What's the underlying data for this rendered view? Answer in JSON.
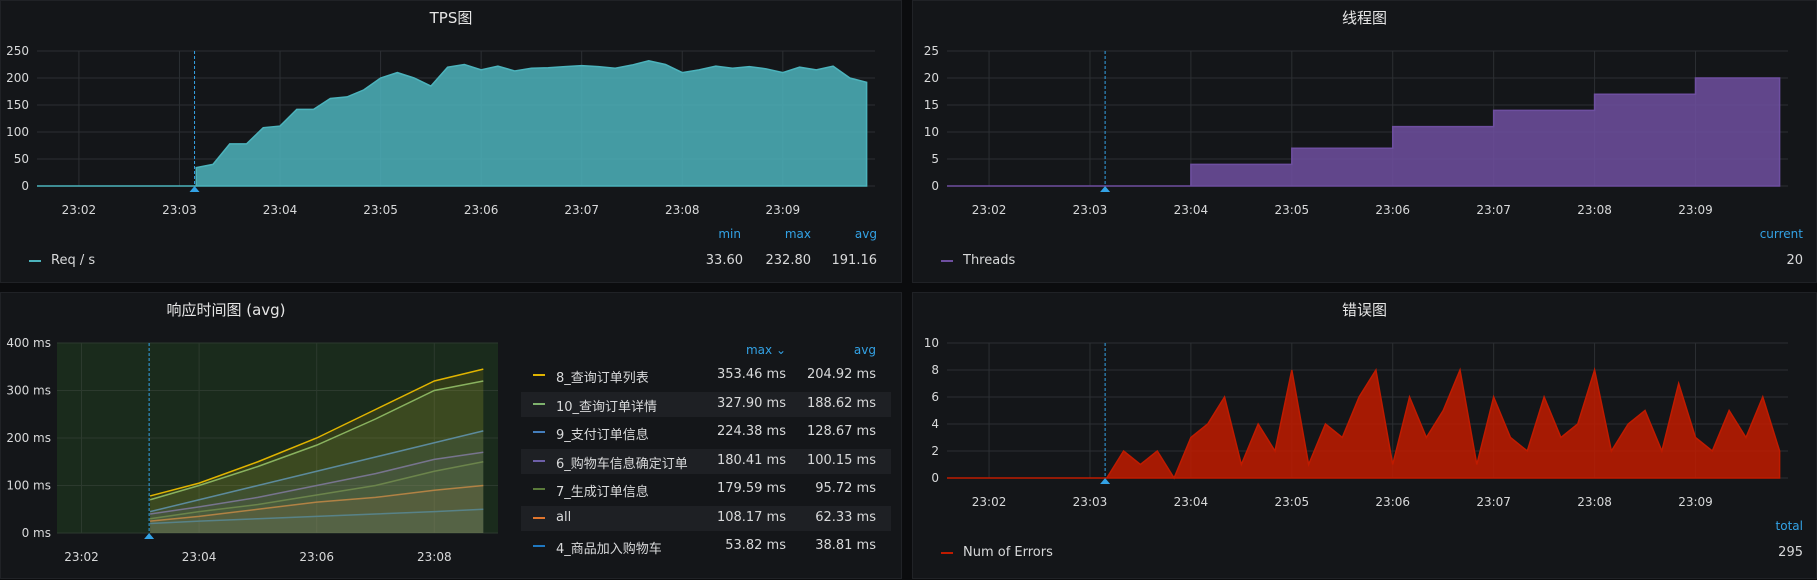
{
  "panels": {
    "tps": {
      "title": "TPS图",
      "yticks": [
        "250",
        "200",
        "150",
        "100",
        "50",
        "0"
      ],
      "xticks": [
        "23:02",
        "23:03",
        "23:04",
        "23:05",
        "23:06",
        "23:07",
        "23:08",
        "23:09"
      ],
      "legend_heads": {
        "min": "min",
        "max": "max",
        "avg": "avg"
      },
      "series_name": "Req / s",
      "stats": {
        "min": "33.60",
        "max": "232.80",
        "avg": "191.16"
      },
      "color": "#4cb3bc"
    },
    "threads": {
      "title": "线程图",
      "yticks": [
        "25",
        "20",
        "15",
        "10",
        "5",
        "0"
      ],
      "xticks": [
        "23:02",
        "23:03",
        "23:04",
        "23:05",
        "23:06",
        "23:07",
        "23:08",
        "23:09"
      ],
      "legend_head": "current",
      "series_name": "Threads",
      "current": "20",
      "color": "#6e4fa0"
    },
    "response": {
      "title": "响应时间图 (avg)",
      "yticks": [
        "400 ms",
        "300 ms",
        "200 ms",
        "100 ms",
        "0 ms"
      ],
      "xticks": [
        "23:02",
        "23:04",
        "23:06",
        "23:08"
      ],
      "legend_heads": {
        "max": "max ⌄",
        "avg": "avg"
      },
      "rows": [
        {
          "name": "8_查询订单列表",
          "max": "353.46 ms",
          "avg": "204.92 ms",
          "color": "#e0b400"
        },
        {
          "name": "10_查询订单详情",
          "max": "327.90 ms",
          "avg": "188.62 ms",
          "color": "#7eb26d"
        },
        {
          "name": "9_支付订单信息",
          "max": "224.38 ms",
          "avg": "128.67 ms",
          "color": "#447ebc"
        },
        {
          "name": "6_购物车信息确定订单",
          "max": "180.41 ms",
          "avg": "100.15 ms",
          "color": "#6d5fa8"
        },
        {
          "name": "7_生成订单信息",
          "max": "179.59 ms",
          "avg": "95.72 ms",
          "color": "#5a7a3a"
        },
        {
          "name": "all",
          "max": "108.17 ms",
          "avg": "62.33 ms",
          "color": "#e0752d"
        },
        {
          "name": "4_商品加入购物车",
          "max": "53.82 ms",
          "avg": "38.81 ms",
          "color": "#1f78c1"
        }
      ]
    },
    "errors": {
      "title": "错误图",
      "yticks": [
        "10",
        "8",
        "6",
        "4",
        "2",
        "0"
      ],
      "xticks": [
        "23:02",
        "23:03",
        "23:04",
        "23:05",
        "23:06",
        "23:07",
        "23:08",
        "23:09"
      ],
      "legend_head": "total",
      "series_name": "Num of Errors",
      "total": "295",
      "color": "#bf1b00"
    }
  },
  "chart_data": [
    {
      "type": "area",
      "title": "TPS图",
      "ylim": [
        0,
        250
      ],
      "x": [
        "23:03:10",
        "23:03:20",
        "23:03:30",
        "23:03:40",
        "23:03:50",
        "23:04:00",
        "23:04:10",
        "23:04:20",
        "23:04:30",
        "23:04:40",
        "23:04:50",
        "23:05:00",
        "23:05:10",
        "23:05:20",
        "23:05:30",
        "23:05:40",
        "23:05:50",
        "23:06:00",
        "23:06:10",
        "23:06:20",
        "23:06:30",
        "23:06:40",
        "23:06:50",
        "23:07:00",
        "23:07:10",
        "23:07:20",
        "23:07:30",
        "23:07:40",
        "23:07:50",
        "23:08:00",
        "23:08:10",
        "23:08:20",
        "23:08:30",
        "23:08:40",
        "23:08:50",
        "23:09:00",
        "23:09:10",
        "23:09:20",
        "23:09:30",
        "23:09:40",
        "23:09:50"
      ],
      "series": [
        {
          "name": "Req / s",
          "values": [
            34,
            40,
            78,
            78,
            108,
            111,
            142,
            142,
            162,
            165,
            178,
            200,
            210,
            200,
            185,
            220,
            225,
            215,
            222,
            213,
            218,
            219,
            221,
            223,
            221,
            218,
            224,
            232,
            225,
            210,
            215,
            222,
            218,
            221,
            217,
            210,
            220,
            215,
            222,
            200,
            192
          ]
        }
      ]
    },
    {
      "type": "area",
      "title": "线程图",
      "ylim": [
        0,
        25
      ],
      "x": [
        "23:03",
        "23:04",
        "23:05",
        "23:06",
        "23:07",
        "23:08",
        "23:09",
        "23:09:50"
      ],
      "series": [
        {
          "name": "Threads",
          "values": [
            0,
            4,
            7,
            11,
            14,
            17,
            20,
            20
          ]
        }
      ]
    },
    {
      "type": "line",
      "title": "响应时间图 (avg)",
      "ylim": [
        0,
        400
      ],
      "x": [
        "23:03:10",
        "23:04",
        "23:05",
        "23:06",
        "23:07",
        "23:08",
        "23:08:50"
      ],
      "series": [
        {
          "name": "8_查询订单列表",
          "values": [
            78,
            105,
            150,
            200,
            260,
            320,
            345
          ]
        },
        {
          "name": "10_查询订单详情",
          "values": [
            70,
            100,
            140,
            185,
            240,
            300,
            320
          ]
        },
        {
          "name": "9_支付订单信息",
          "values": [
            45,
            70,
            100,
            130,
            160,
            190,
            215
          ]
        },
        {
          "name": "6_购物车信息确定订单",
          "values": [
            40,
            55,
            75,
            100,
            125,
            155,
            170
          ]
        },
        {
          "name": "7_生成订单信息",
          "values": [
            30,
            45,
            60,
            80,
            100,
            130,
            150
          ]
        },
        {
          "name": "all",
          "values": [
            25,
            35,
            50,
            65,
            75,
            90,
            100
          ]
        },
        {
          "name": "4_商品加入购物车",
          "values": [
            20,
            25,
            30,
            35,
            40,
            45,
            50
          ]
        }
      ]
    },
    {
      "type": "area",
      "title": "错误图",
      "ylim": [
        0,
        10
      ],
      "x": [
        "23:03:10",
        "23:03:20",
        "23:03:30",
        "23:03:40",
        "23:03:50",
        "23:04:00",
        "23:04:10",
        "23:04:20",
        "23:04:30",
        "23:04:40",
        "23:04:50",
        "23:05:00",
        "23:05:10",
        "23:05:20",
        "23:05:30",
        "23:05:40",
        "23:05:50",
        "23:06:00",
        "23:06:10",
        "23:06:20",
        "23:06:30",
        "23:06:40",
        "23:06:50",
        "23:07:00",
        "23:07:10",
        "23:07:20",
        "23:07:30",
        "23:07:40",
        "23:07:50",
        "23:08:00",
        "23:08:10",
        "23:08:20",
        "23:08:30",
        "23:08:40",
        "23:08:50",
        "23:09:00",
        "23:09:10",
        "23:09:20",
        "23:09:30",
        "23:09:40",
        "23:09:50"
      ],
      "series": [
        {
          "name": "Num of Errors",
          "values": [
            0,
            2,
            1,
            2,
            0,
            3,
            4,
            6,
            1,
            4,
            2,
            8,
            1,
            4,
            3,
            6,
            8,
            1,
            6,
            3,
            5,
            8,
            1,
            6,
            3,
            2,
            6,
            3,
            4,
            8,
            2,
            4,
            5,
            2,
            7,
            3,
            2,
            5,
            3,
            6,
            2
          ]
        }
      ]
    }
  ]
}
